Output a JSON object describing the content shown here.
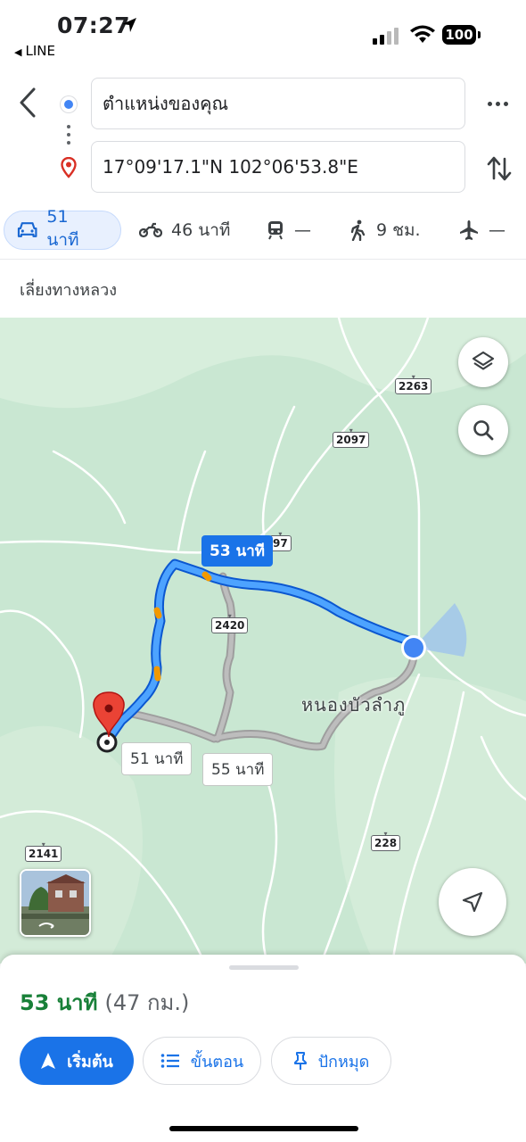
{
  "status": {
    "time": "07:27",
    "back_app": "LINE",
    "battery": "100"
  },
  "directions": {
    "origin": "ตำแหน่งของคุณ",
    "destination": "17°09'17.1\"N 102°06'53.8\"E"
  },
  "modes": [
    {
      "name": "car",
      "label": "51 นาที",
      "active": true
    },
    {
      "name": "motorcycle",
      "label": "46 นาที"
    },
    {
      "name": "transit",
      "label": "—"
    },
    {
      "name": "walk",
      "label": "9 ชม."
    },
    {
      "name": "flight",
      "label": "—"
    }
  ],
  "route_note": "เลี่ยงทางหลวง",
  "map": {
    "place_label": "หนองบัวลำภู",
    "route_bubbles": {
      "main": "53 นาที",
      "alt1": "51 นาที",
      "alt2": "55 นาที"
    },
    "road_shields": {
      "r2263": "2263",
      "r2097": "2097",
      "r2097_partial": "97",
      "r2420": "2420",
      "r2141": "2141",
      "r228": "228"
    }
  },
  "summary": {
    "duration": "53 นาที",
    "distance": "(47 กม.)"
  },
  "actions": {
    "start": "เริ่มต้น",
    "steps": "ขั้นตอน",
    "pin": "ปักหมุด"
  },
  "colors": {
    "route_primary": "#1a73e8",
    "route_alt": "#a8a8a8",
    "map_green": "#c9e7d2",
    "destination_pin": "#ea4335",
    "duration_green": "#188038"
  }
}
